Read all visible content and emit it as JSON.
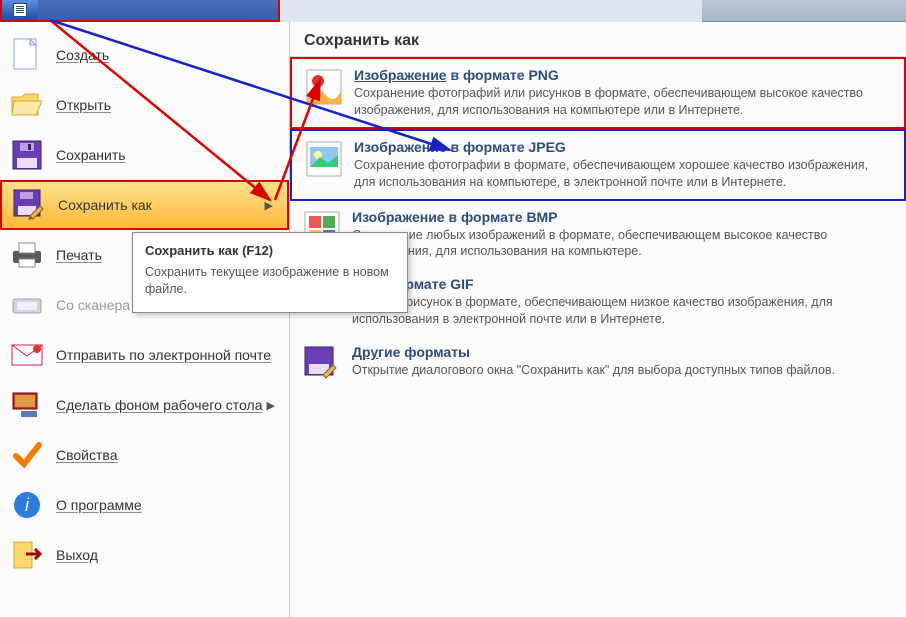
{
  "left_menu": {
    "create": "Создать",
    "open": "Открыть",
    "save": "Сохранить",
    "save_as": "Сохранить как",
    "print": "Печать",
    "scanner": "Со сканера или камеры",
    "email": "Отправить по электронной почте",
    "wallpaper": "Сделать фоном рабочего стола",
    "properties": "Свойства",
    "about": "О программе",
    "exit": "Выход"
  },
  "right_panel": {
    "header": "Сохранить как",
    "png": {
      "title_pre": "Изображение",
      "title_post": " в формате PNG",
      "desc": "Сохранение фотографий или рисунков в формате, обеспечивающем высокое качество изображения, для использования на компьютере или в Интернете."
    },
    "jpeg": {
      "title": "Изображение в формате JPEG",
      "desc": "Сохранение фотографии в формате, обеспечивающем хорошее качество изображения, для использования на компьютере, в электронной почте или в Интернете."
    },
    "bmp": {
      "title": "Изображение в формате BMP",
      "desc": "Сохранение любых изображений в формате, обеспечивающем высокое качество изображения, для использования на компьютере."
    },
    "gif": {
      "title_frag": "ие в формате GIF",
      "desc": "простого рисунок в формате, обеспечивающем низкое качество изображения, для использования в электронной почте или в Интернете."
    },
    "other": {
      "title_pre": "Дру",
      "title_post": "гие форматы",
      "desc": "Открытие диалогового окна \"Сохранить как\" для выбора доступных типов файлов."
    }
  },
  "tooltip": {
    "title": "Сохранить как (F12)",
    "body": "Сохранить текущее изображение в новом файле."
  }
}
